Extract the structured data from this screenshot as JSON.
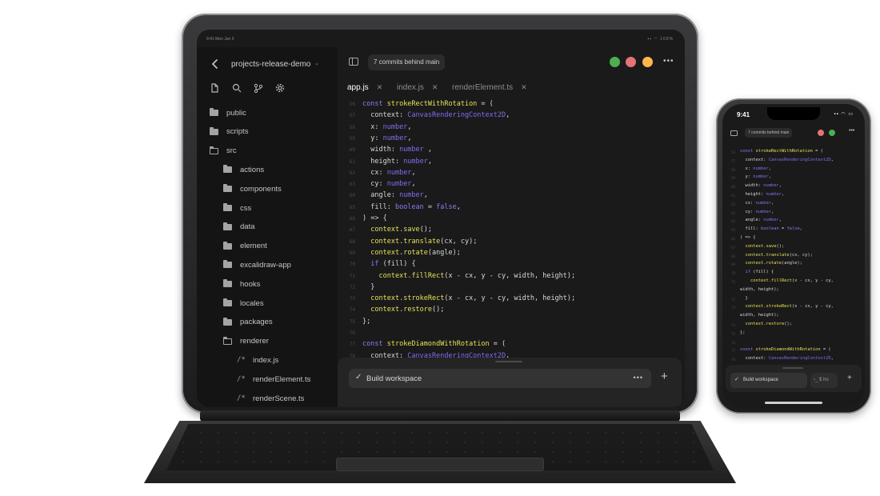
{
  "ipad": {
    "status": {
      "time": "9:41 Mon Jun 3",
      "battery": "100%"
    },
    "sidebar": {
      "project_name": "projects-release-demo",
      "tree": [
        {
          "label": "public",
          "kind": "folder",
          "depth": 0
        },
        {
          "label": "scripts",
          "kind": "folder",
          "depth": 0
        },
        {
          "label": "src",
          "kind": "folder-open",
          "depth": 0
        },
        {
          "label": "actions",
          "kind": "folder",
          "depth": 1
        },
        {
          "label": "components",
          "kind": "folder",
          "depth": 1
        },
        {
          "label": "css",
          "kind": "folder",
          "depth": 1
        },
        {
          "label": "data",
          "kind": "folder",
          "depth": 1
        },
        {
          "label": "element",
          "kind": "folder",
          "depth": 1
        },
        {
          "label": "excalidraw-app",
          "kind": "folder",
          "depth": 1
        },
        {
          "label": "hooks",
          "kind": "folder",
          "depth": 1
        },
        {
          "label": "locales",
          "kind": "folder",
          "depth": 1
        },
        {
          "label": "packages",
          "kind": "folder",
          "depth": 1
        },
        {
          "label": "renderer",
          "kind": "folder-open",
          "depth": 1
        },
        {
          "label": "index.js",
          "kind": "file",
          "depth": 2
        },
        {
          "label": "renderElement.ts",
          "kind": "file",
          "depth": 2
        },
        {
          "label": "renderScene.ts",
          "kind": "file",
          "depth": 2
        }
      ]
    },
    "topbar": {
      "commits_label": "7 commits behind main",
      "avatar_colors": [
        "#4caf50",
        "#e57373",
        "#ffb74d"
      ]
    },
    "tabs": [
      {
        "label": "app.js",
        "active": true
      },
      {
        "label": "index.js",
        "active": false
      },
      {
        "label": "renderElement.ts",
        "active": false
      }
    ],
    "code": [
      {
        "n": "56",
        "t": "const strokeRectWithRotation = ("
      },
      {
        "n": "57",
        "t": "  context: CanvasRenderingContext2D,"
      },
      {
        "n": "58",
        "t": "  x: number,"
      },
      {
        "n": "59",
        "t": "  y: number,"
      },
      {
        "n": "60",
        "t": "  width: number ,"
      },
      {
        "n": "61",
        "t": "  height: number,"
      },
      {
        "n": "62",
        "t": "  cx: number,"
      },
      {
        "n": "63",
        "t": "  cy: number,"
      },
      {
        "n": "64",
        "t": "  angle: number,"
      },
      {
        "n": "65",
        "t": "  fill: boolean = false,"
      },
      {
        "n": "66",
        "t": ") => {"
      },
      {
        "n": "67",
        "t": "  context.save();"
      },
      {
        "n": "68",
        "t": "  context.translate(cx, cy);"
      },
      {
        "n": "69",
        "t": "  context.rotate(angle);"
      },
      {
        "n": "70",
        "t": "  if (fill) {"
      },
      {
        "n": "71",
        "t": "    context.fillRect(x - cx, y - cy, width, height);"
      },
      {
        "n": "72",
        "t": "  }"
      },
      {
        "n": "73",
        "t": "  context.strokeRect(x - cx, y - cy, width, height);"
      },
      {
        "n": "74",
        "t": "  context.restore();"
      },
      {
        "n": "75",
        "t": "};"
      },
      {
        "n": "76",
        "t": ""
      },
      {
        "n": "77",
        "t": "const strokeDiamondWithRotation = ("
      },
      {
        "n": "78",
        "t": "  context: CanvasRenderingContext2D,"
      }
    ],
    "build": {
      "label": "Build workspace"
    }
  },
  "phone": {
    "time": "9:41",
    "commits_label": "7 commits behind main",
    "avatar_colors": [
      "#e57373",
      "#4caf50"
    ],
    "code": [
      {
        "n": "56",
        "t": "const strokeRectWithRotation = ("
      },
      {
        "n": "57",
        "t": "  context: CanvasRenderingContext2D,"
      },
      {
        "n": "58",
        "t": "  x: number,"
      },
      {
        "n": "59",
        "t": "  y: number,"
      },
      {
        "n": "60",
        "t": "  width: number,"
      },
      {
        "n": "61",
        "t": "  height: number,"
      },
      {
        "n": "62",
        "t": "  cx: number,"
      },
      {
        "n": "63",
        "t": "  cy: number,"
      },
      {
        "n": "64",
        "t": "  angle: number,"
      },
      {
        "n": "65",
        "t": "  fill: boolean = false,"
      },
      {
        "n": "66",
        "t": ") => {"
      },
      {
        "n": "67",
        "t": "  context.save();"
      },
      {
        "n": "68",
        "t": "  context.translate(cx, cy);"
      },
      {
        "n": "69",
        "t": "  context.rotate(angle);"
      },
      {
        "n": "70",
        "t": "  if (fill) {"
      },
      {
        "n": "71",
        "t": "    context.fillRect(x - cx, y - cy,"
      },
      {
        "n": "",
        "t": "width, height);"
      },
      {
        "n": "72",
        "t": "  }"
      },
      {
        "n": "73",
        "t": "  context.strokeRect(x - cx, y - cy,"
      },
      {
        "n": "",
        "t": "width, height);"
      },
      {
        "n": "74",
        "t": "  context.restore();"
      },
      {
        "n": "75",
        "t": "};"
      },
      {
        "n": "76",
        "t": ""
      },
      {
        "n": "77",
        "t": "const strokeDiamondWithRotation = ("
      },
      {
        "n": "78",
        "t": "  context: CanvasRenderingContext2D,"
      }
    ],
    "build": {
      "label": "Build workspace",
      "terminal_label": "$ ho"
    }
  },
  "icons": {
    "back": "chevron-left-icon",
    "chevron_down": "chevron-down-icon",
    "file": "file-icon",
    "search": "search-icon",
    "git": "git-branch-icon",
    "settings": "gear-icon",
    "panel": "sidebar-toggle-icon",
    "more": "more-horizontal-icon",
    "close": "close-icon",
    "check": "check-icon",
    "plus": "plus-icon",
    "folder": "folder-icon",
    "terminal": "terminal-icon"
  }
}
